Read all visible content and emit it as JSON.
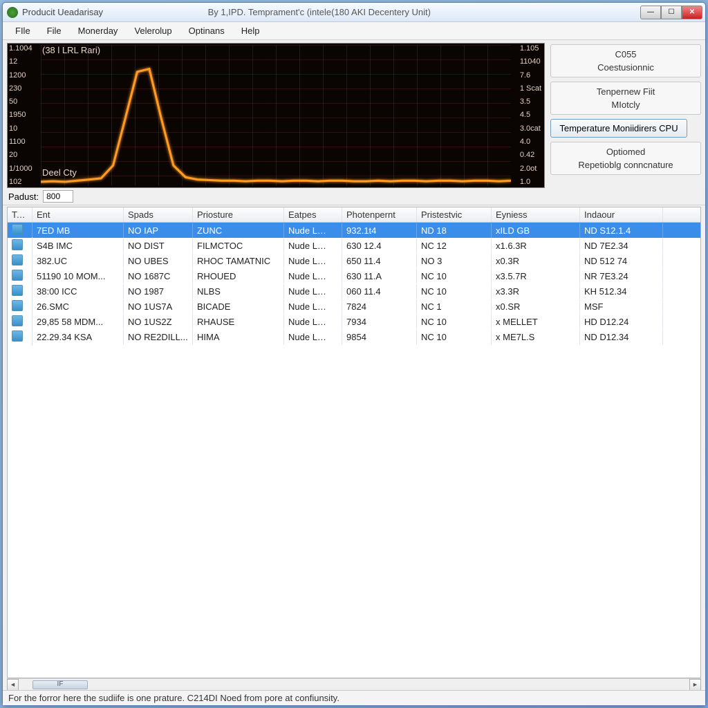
{
  "titlebar": {
    "app_title": "Producit Ueadarisay",
    "subtitle": "By 1,IPD. Temprament'c (intele(180 AKI Decentery Unit)"
  },
  "menu": [
    "FIle",
    "File",
    "Monerday",
    "Velerolup",
    "Optinans",
    "Help"
  ],
  "chart_data": {
    "type": "line",
    "title_top_left": "(38 l LRL Rari)",
    "label_bottom_left": "Deel Cty",
    "y_left_ticks": [
      "1.1004",
      "12",
      "1200",
      "230",
      "50",
      "1950",
      "10",
      "1100",
      "20",
      "1/1000",
      "102"
    ],
    "y_right_ticks": [
      "1.105",
      "11040",
      "7.6",
      "1 Scat",
      "3.5",
      "4.5",
      "3.0cat",
      "4.0",
      "0.42",
      "2.0ot",
      "1.0"
    ],
    "x": [
      0,
      1,
      2,
      3,
      4,
      5,
      6,
      7,
      8,
      9,
      10,
      11,
      12,
      13,
      14,
      15,
      16,
      17,
      18,
      19,
      20,
      21,
      22,
      23,
      24,
      25,
      26,
      27,
      28,
      29,
      30,
      31,
      32,
      33,
      34,
      35,
      36,
      37,
      38,
      39
    ],
    "values": [
      12,
      13,
      12,
      14,
      16,
      18,
      40,
      120,
      200,
      205,
      120,
      40,
      20,
      16,
      15,
      14,
      14,
      13,
      14,
      14,
      13,
      14,
      14,
      13,
      14,
      14,
      13,
      13,
      14,
      13,
      14,
      14,
      13,
      14,
      14,
      13,
      14,
      14,
      13,
      14
    ],
    "ylim": [
      0,
      230
    ],
    "color": "#ff9a20"
  },
  "side": {
    "group1": {
      "line1": "C055",
      "line2": "Coestusionnic"
    },
    "group2": {
      "line1": "Tenpernew Fiit",
      "line2": "MIotcly"
    },
    "button": "Temperature Moniidirers CPU",
    "group3": {
      "line1": "Optiomed",
      "line2": "Repetioblg conncnature"
    }
  },
  "filter": {
    "label": "Padust:",
    "value": "800"
  },
  "table": {
    "columns": [
      "Tepl",
      "Ent",
      "Spads",
      "Priosture",
      "Eatpes",
      "Photenpernt",
      "Pristestvic",
      "Eyniess",
      "Indaour"
    ],
    "rows": [
      {
        "sel": true,
        "c1": "7ED MB",
        "c2": "NO IAP",
        "c3": "ZUNC",
        "c4": "Nude L…",
        "c5": "932.1t4",
        "c6": "ND 18",
        "c7": "xILD GB",
        "c8": "ND S12.1.4"
      },
      {
        "sel": false,
        "c1": "S4B IMC",
        "c2": "NO DIST",
        "c3": "FILMCTOC",
        "c4": "Nude L…",
        "c5": "630 12.4",
        "c6": "NC 12",
        "c7": "x1.6.3R",
        "c8": "ND 7E2.34"
      },
      {
        "sel": false,
        "c1": "382.UC",
        "c2": "NO UBES",
        "c3": "RHOC TAMATNIC",
        "c4": "Nude L…",
        "c5": "650 11.4",
        "c6": "NO 3",
        "c7": "x0.3R",
        "c8": "ND 512 74"
      },
      {
        "sel": false,
        "c1": "51190 10 MOM...",
        "c2": "NO 1687C",
        "c3": "RHOUED",
        "c4": "Nude L…",
        "c5": "630 11.A",
        "c6": "NC 10",
        "c7": "x3.5.7R",
        "c8": "NR 7E3.24"
      },
      {
        "sel": false,
        "c1": "38:00 ICC",
        "c2": "NO 1987",
        "c3": "NLBS",
        "c4": "Nude L…",
        "c5": "060 11.4",
        "c6": "NC 10",
        "c7": "x3.3R",
        "c8": "KH 512.34"
      },
      {
        "sel": false,
        "c1": "26.SMC",
        "c2": "NO 1US7A",
        "c3": "BICADE",
        "c4": "Nude L…",
        "c5": "7824",
        "c6": "NC 1",
        "c7": "x0.SR",
        "c8": "MSF"
      },
      {
        "sel": false,
        "c1": "29,85 58 MDM...",
        "c2": "NO 1US2Z",
        "c3": "RHAUSE",
        "c4": "Nude L…",
        "c5": "7934",
        "c6": "NC 10",
        "c7": "x MELLET",
        "c8": "HD D12.24"
      },
      {
        "sel": false,
        "c1": "22.29.34 KSA",
        "c2": "NO RE2DILL...",
        "c3": "HIMA",
        "c4": "Nude L…",
        "c5": "9854",
        "c6": "NC 10",
        "c7": "x ME7L.S",
        "c8": "ND D12.34"
      }
    ],
    "hscroll_label": "IF"
  },
  "statusbar": "For the forror here the sudiife is one prature. C214DI Noed from pore at confiunsity."
}
